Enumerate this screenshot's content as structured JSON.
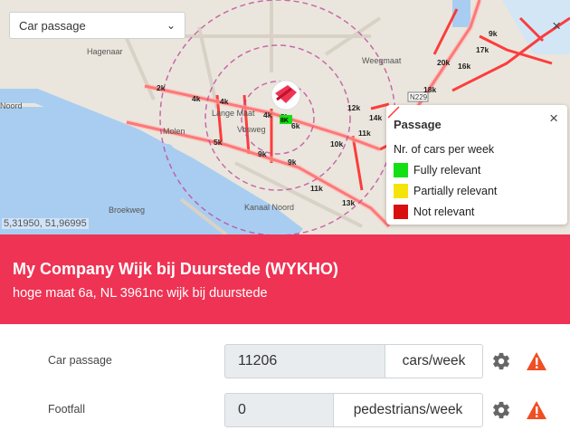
{
  "map": {
    "layer_select": "Car passage",
    "coordinates": "5,31950, 51,96995",
    "street_names": [
      "Hagenaar",
      "Noord",
      "Molen",
      "Lange Maat",
      "Vosweg",
      "Weegmaat",
      "Kanaal Noord",
      "Broekweg"
    ],
    "traffic_labels": [
      "2k",
      "4k",
      "4k",
      "4k",
      "5k",
      "6k",
      "8k",
      "9k",
      "9k",
      "10k",
      "11k",
      "11k",
      "12k",
      "13k",
      "14k",
      "16k",
      "17k",
      "18k",
      "20k",
      "9k"
    ],
    "road_sign": "N229",
    "marker_label": "8K",
    "colors": {
      "water": "#a9cdf0",
      "land": "#eae6dd",
      "traffic": "#ff2b2b"
    }
  },
  "legend": {
    "title": "Passage",
    "close": "×",
    "items": [
      {
        "label": "Nr. of cars per week",
        "type": "line",
        "color": "#ff3b3b"
      },
      {
        "label": "Fully relevant",
        "type": "swatch",
        "color": "#12e012"
      },
      {
        "label": "Partially relevant",
        "type": "swatch",
        "color": "#f5e40a"
      },
      {
        "label": "Not relevant",
        "type": "swatch",
        "color": "#d90f0f"
      }
    ]
  },
  "location": {
    "name": "My Company Wijk bij Duurstede (WYKHO)",
    "address": "hoge maat 6a, NL 3961nc wijk bij duurstede",
    "banner_color": "#ef3354"
  },
  "fields": [
    {
      "label": "Car passage",
      "value": "11206",
      "unit": "cars/week"
    },
    {
      "label": "Footfall",
      "value": "0",
      "unit": "pedestrians/week"
    }
  ],
  "icons": {
    "settings": "gear-icon",
    "warning": "warning-icon",
    "warning_color": "#f04e23"
  }
}
